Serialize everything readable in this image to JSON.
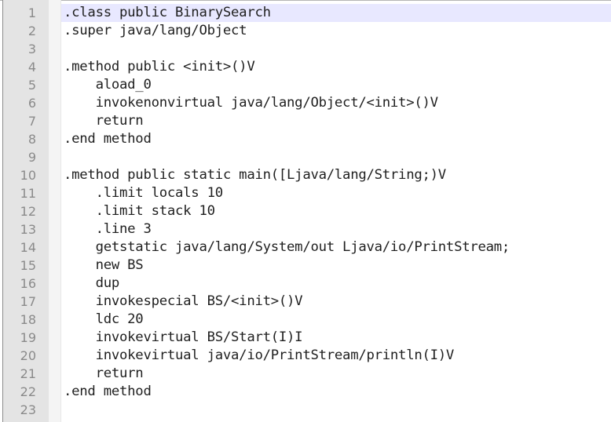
{
  "editor": {
    "lines": [
      {
        "number": "1",
        "text": ".class public BinarySearch"
      },
      {
        "number": "2",
        "text": ".super java/lang/Object"
      },
      {
        "number": "3",
        "text": ""
      },
      {
        "number": "4",
        "text": ".method public <init>()V"
      },
      {
        "number": "5",
        "text": "    aload_0"
      },
      {
        "number": "6",
        "text": "    invokenonvirtual java/lang/Object/<init>()V"
      },
      {
        "number": "7",
        "text": "    return"
      },
      {
        "number": "8",
        "text": ".end method"
      },
      {
        "number": "9",
        "text": ""
      },
      {
        "number": "10",
        "text": ".method public static main([Ljava/lang/String;)V"
      },
      {
        "number": "11",
        "text": "    .limit locals 10"
      },
      {
        "number": "12",
        "text": "    .limit stack 10"
      },
      {
        "number": "13",
        "text": "    .line 3"
      },
      {
        "number": "14",
        "text": "    getstatic java/lang/System/out Ljava/io/PrintStream;"
      },
      {
        "number": "15",
        "text": "    new BS"
      },
      {
        "number": "16",
        "text": "    dup"
      },
      {
        "number": "17",
        "text": "    invokespecial BS/<init>()V"
      },
      {
        "number": "18",
        "text": "    ldc 20"
      },
      {
        "number": "19",
        "text": "    invokevirtual BS/Start(I)I"
      },
      {
        "number": "20",
        "text": "    invokevirtual java/io/PrintStream/println(I)V"
      },
      {
        "number": "21",
        "text": "    return"
      },
      {
        "number": "22",
        "text": ".end method"
      },
      {
        "number": "23",
        "text": ""
      }
    ]
  },
  "colors": {
    "gutter_background": "#e4e4e4",
    "line_number": "#8a8a8a",
    "current_line_highlight": "#e8e8ff",
    "code_text": "#1f1f1f"
  }
}
